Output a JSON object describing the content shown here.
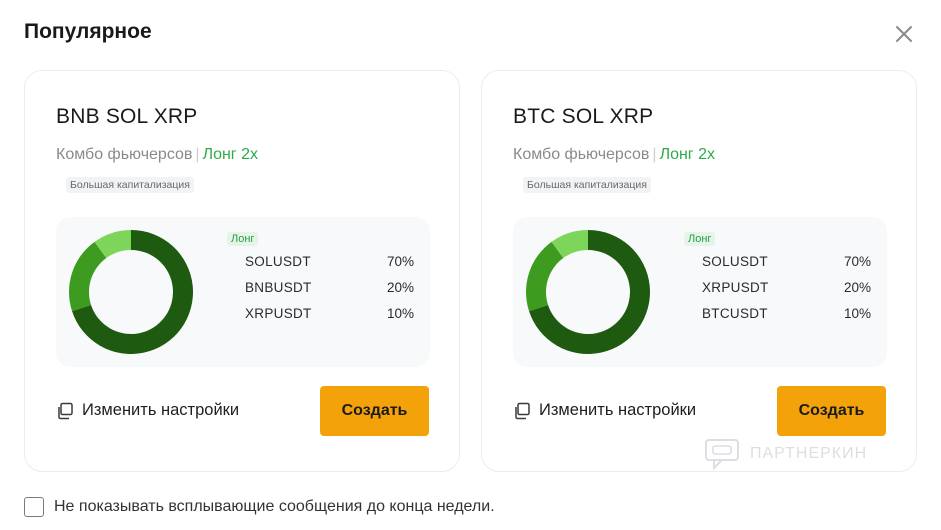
{
  "modal": {
    "title": "Популярное",
    "footer_checkbox_label": "Не показывать всплывающие сообщения до конца недели.",
    "footer_checkbox_checked": false
  },
  "watermark": {
    "text": "ПАРТНЕРКИН"
  },
  "colors": {
    "primary_button": "#f4a20a",
    "long_green": "#2daa4a",
    "slice_1": "#1e5a0f",
    "slice_2": "#3d9c1f",
    "slice_3": "#7dd65a"
  },
  "cards": [
    {
      "title": "BNB SOL XRP",
      "subtitle_type": "Комбо фьючерсов",
      "subtitle_separator": "|",
      "subtitle_leverage": "Лонг 2x",
      "tag": "Большая капитализация",
      "legend_badge": "Лонг",
      "allocations": [
        {
          "symbol": "SOLUSDT",
          "percent_label": "70%",
          "value": 70
        },
        {
          "symbol": "BNBUSDT",
          "percent_label": "20%",
          "value": 20
        },
        {
          "symbol": "XRPUSDT",
          "percent_label": "10%",
          "value": 10
        }
      ],
      "settings_label": "Изменить настройки",
      "create_label": "Создать"
    },
    {
      "title": "BTC SOL XRP",
      "subtitle_type": "Комбо фьючерсов",
      "subtitle_separator": "|",
      "subtitle_leverage": "Лонг 2x",
      "tag": "Большая капитализация",
      "legend_badge": "Лонг",
      "allocations": [
        {
          "symbol": "SOLUSDT",
          "percent_label": "70%",
          "value": 70
        },
        {
          "symbol": "XRPUSDT",
          "percent_label": "20%",
          "value": 20
        },
        {
          "symbol": "BTCUSDT",
          "percent_label": "10%",
          "value": 10
        }
      ],
      "settings_label": "Изменить настройки",
      "create_label": "Создать"
    }
  ]
}
